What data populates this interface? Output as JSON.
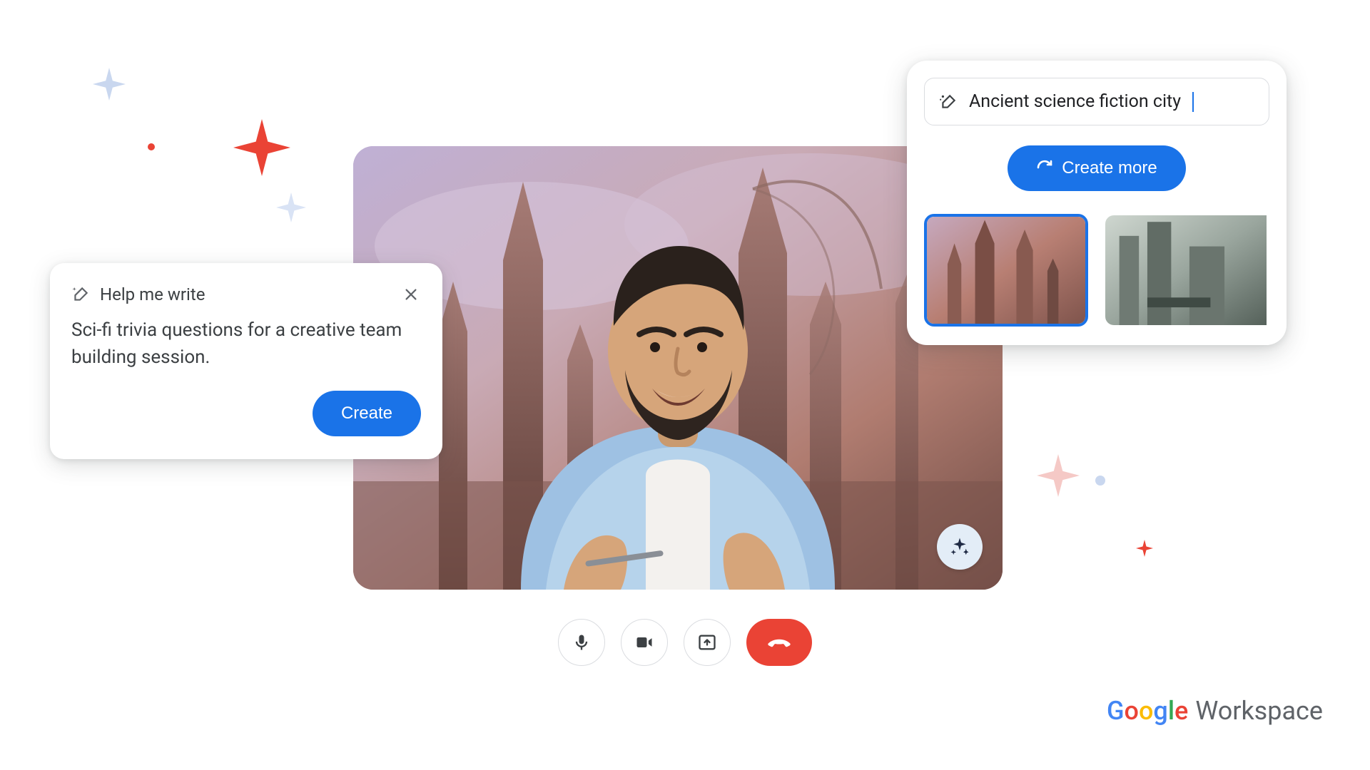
{
  "help_me_write": {
    "title": "Help me write",
    "body": "Sci-fi trivia questions for a creative team building session.",
    "create_label": "Create"
  },
  "image_gen": {
    "prompt": "Ancient science fiction city",
    "create_more_label": "Create more",
    "thumbnails": [
      {
        "id": "thumb-1",
        "selected": true,
        "palette": [
          "#c6a9bf",
          "#b87f73",
          "#7f544c"
        ]
      },
      {
        "id": "thumb-2",
        "selected": false,
        "palette": [
          "#b9c4bd",
          "#7e8b84",
          "#4e5a54"
        ]
      }
    ]
  },
  "controls": {
    "mic": "microphone",
    "camera": "camera",
    "present": "present-screen",
    "end": "end-call"
  },
  "brand": {
    "google": "Google",
    "workspace": "Workspace"
  },
  "colors": {
    "primary": "#1a73e8",
    "danger": "#ea4335"
  }
}
